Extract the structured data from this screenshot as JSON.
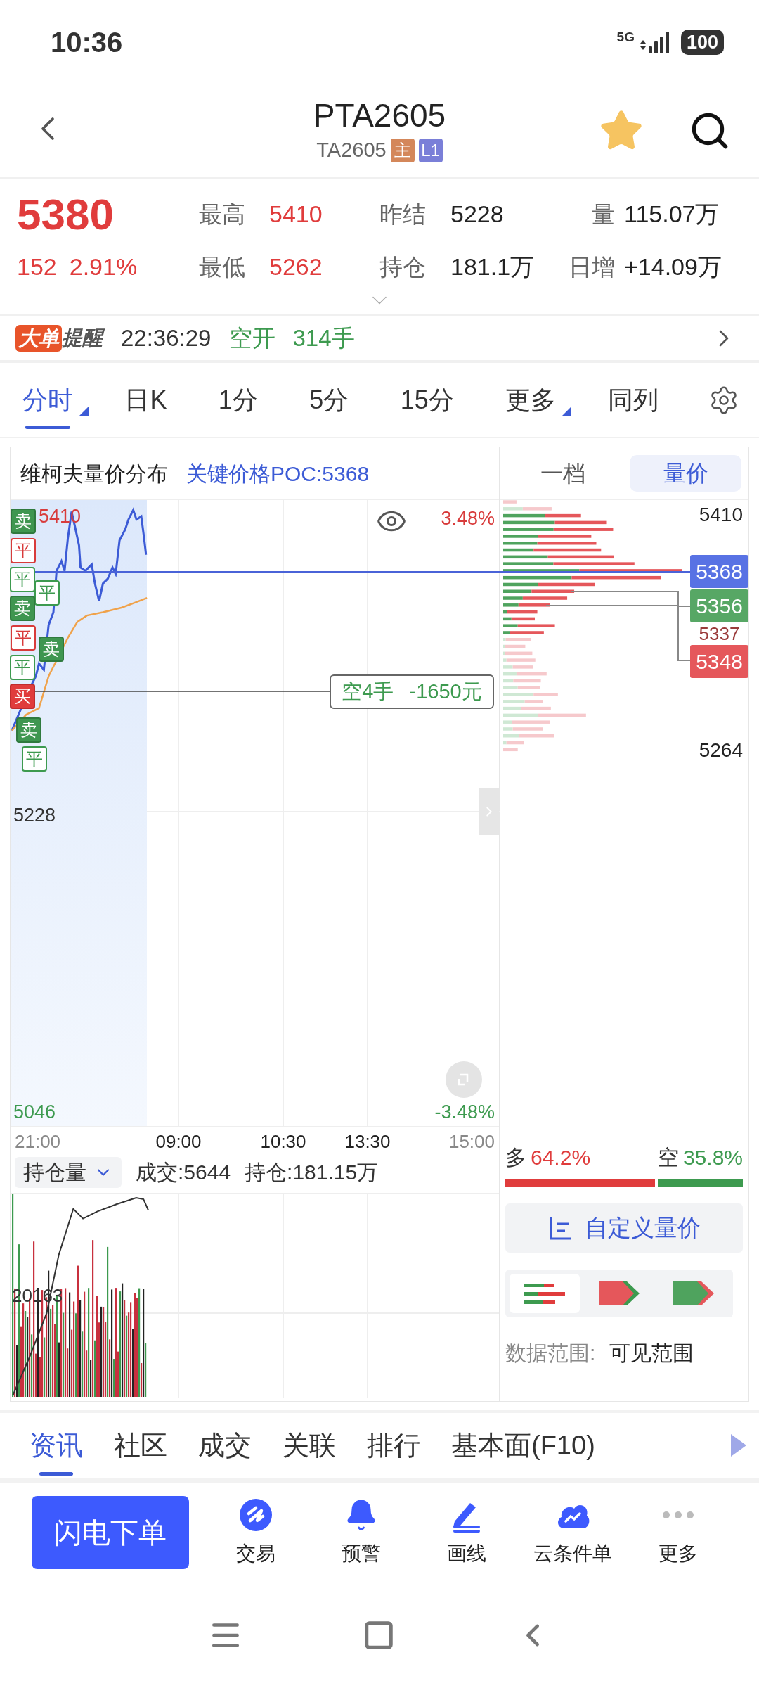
{
  "status_bar": {
    "time": "10:36",
    "network": "5G",
    "battery": "100"
  },
  "header": {
    "title": "PTA2605",
    "code": "TA2605",
    "favorite": true,
    "badges": [
      {
        "text": "主",
        "color": "#d4875a"
      },
      {
        "text": "L1",
        "color": "#7a7fd8"
      }
    ]
  },
  "quote": {
    "price": "5380",
    "change": "152",
    "change_pct": "2.91%",
    "stats": [
      {
        "label": "最高",
        "value": "5410",
        "color": "#e03c3c"
      },
      {
        "label": "昨结",
        "value": "5228",
        "color": "#222222"
      },
      {
        "label": "量",
        "value": "115.07万",
        "color": "#222222"
      },
      {
        "label": "最低",
        "value": "5262",
        "color": "#e03c3c"
      },
      {
        "label": "持仓",
        "value": "181.1万",
        "color": "#222222"
      },
      {
        "label": "日增",
        "value": "+14.09万",
        "color": "#222222"
      }
    ]
  },
  "alert": {
    "tag": "大单",
    "title": "提醒",
    "time": "22:36:29",
    "action": "空开",
    "amount": "314手"
  },
  "periods": [
    {
      "label": "分时",
      "selected": true,
      "dropdown": true
    },
    {
      "label": "日K",
      "selected": false,
      "dropdown": false
    },
    {
      "label": "1分",
      "selected": false,
      "dropdown": false
    },
    {
      "label": "5分",
      "selected": false,
      "dropdown": false
    },
    {
      "label": "15分",
      "selected": false,
      "dropdown": false
    },
    {
      "label": "更多",
      "selected": false,
      "dropdown": true
    },
    {
      "label": "同列",
      "selected": false,
      "dropdown": false
    }
  ],
  "chart": {
    "title": "维柯夫量价分布",
    "key_price": "关键价格POC:5368",
    "price_high": "5410",
    "price_mid": "5228",
    "price_low": "5046",
    "pct_high": "3.48%",
    "pct_low": "-3.48%",
    "position": {
      "lots": "空4手",
      "pnl": "-1650元"
    },
    "markers": [
      {
        "text": "卖",
        "kind": "sell"
      },
      {
        "text": "平",
        "kind": "close_red"
      },
      {
        "text": "平",
        "kind": "close_green"
      },
      {
        "text": "平",
        "kind": "close_green"
      },
      {
        "text": "卖",
        "kind": "sell"
      },
      {
        "text": "平",
        "kind": "close_red"
      },
      {
        "text": "卖",
        "kind": "sell"
      },
      {
        "text": "平",
        "kind": "close_green"
      },
      {
        "text": "买",
        "kind": "buy"
      },
      {
        "text": "卖",
        "kind": "sell"
      },
      {
        "text": "平",
        "kind": "close_green"
      }
    ],
    "time_labels": [
      {
        "text": "21:00",
        "kind": "edge"
      },
      {
        "text": "09:00",
        "kind": "session"
      },
      {
        "text": "10:30",
        "kind": "session"
      },
      {
        "text": "13:30",
        "kind": "session"
      },
      {
        "text": "15:00",
        "kind": "edge"
      }
    ]
  },
  "sub_chart": {
    "indicator": "持仓量",
    "volume": "成交:5644",
    "open_interest": "持仓:181.15万",
    "axis_label": "20163"
  },
  "depth_tabs": [
    {
      "label": "一档",
      "selected": false
    },
    {
      "label": "量价",
      "selected": true
    }
  ],
  "profile": {
    "price_high": "5410",
    "price_low": "5264",
    "hidden_price": "5337",
    "tags": [
      {
        "text": "5368",
        "color": "#5872e4"
      },
      {
        "text": "5356",
        "color": "#57a765"
      },
      {
        "text": "5348",
        "color": "#e5575b"
      }
    ]
  },
  "sentiment": {
    "long_label": "多",
    "long_pct": "64.2%",
    "short_label": "空",
    "short_pct": "35.8%",
    "level": 0.642
  },
  "custom_button": "自定义量价",
  "display_modes": [
    {
      "kind": "bars",
      "selected": true
    },
    {
      "kind": "red_arrow",
      "selected": false
    },
    {
      "kind": "green_arrow",
      "selected": false
    }
  ],
  "data_range": {
    "label": "数据范围:",
    "value": "可见范围"
  },
  "info_tabs": [
    {
      "label": "资讯",
      "selected": true
    },
    {
      "label": "社区",
      "selected": false
    },
    {
      "label": "成交",
      "selected": false
    },
    {
      "label": "关联",
      "selected": false
    },
    {
      "label": "排行",
      "selected": false
    },
    {
      "label": "基本面(F10)",
      "selected": false
    }
  ],
  "order_button": "闪电下单",
  "actions": [
    {
      "label": "交易",
      "kind": "trade"
    },
    {
      "label": "预警",
      "kind": "alert"
    },
    {
      "label": "画线",
      "kind": "draw"
    },
    {
      "label": "云条件单",
      "kind": "cloud"
    },
    {
      "label": "更多",
      "kind": "more"
    }
  ]
}
